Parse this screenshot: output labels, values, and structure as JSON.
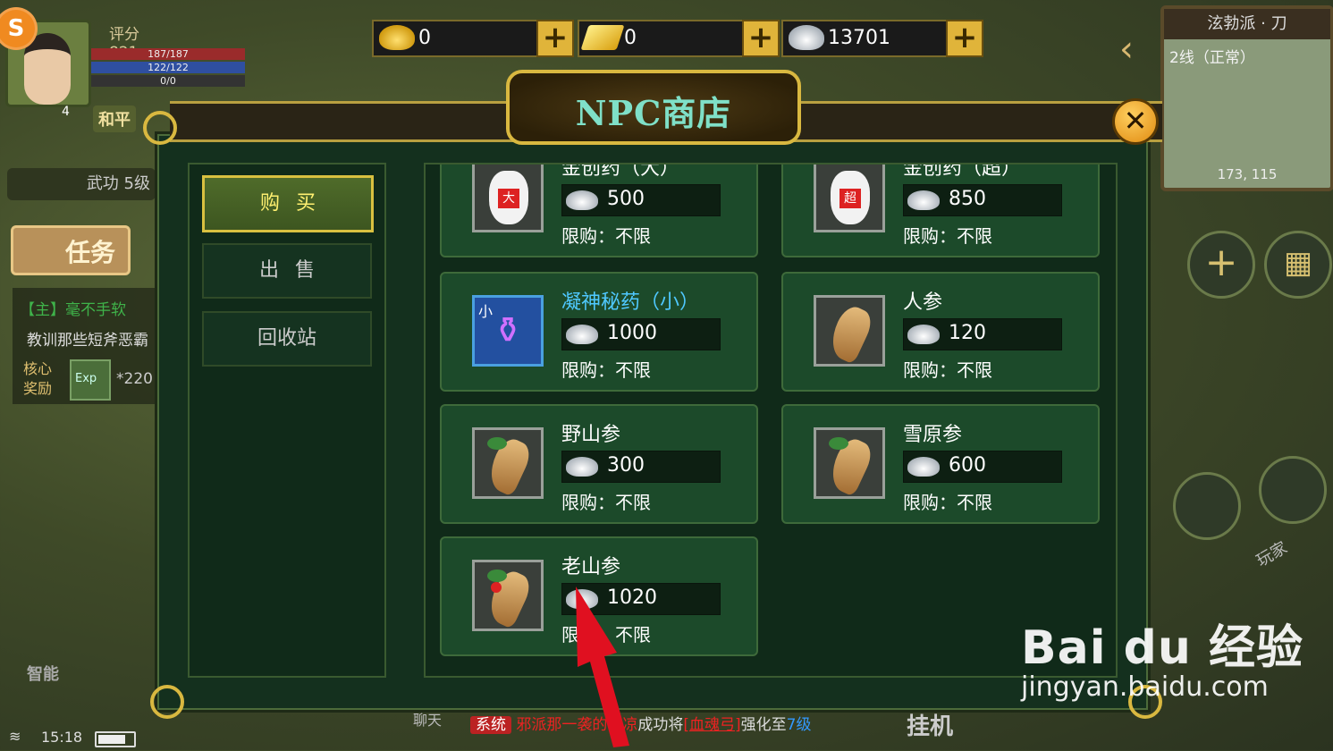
{
  "hud": {
    "score": "评分 821",
    "hp": "187/187",
    "mp": "122/122",
    "sp": "0/0",
    "level": "4",
    "pk_mode": "和平",
    "martial": "武功 5级",
    "task_button": "任务",
    "quest_title": "【主】毫不手软",
    "quest_desc": "教训那些短斧恶霸",
    "reward_label": "核心奖励",
    "reward_icon_text": "Exp",
    "reward_value": "*220",
    "smart_button": "智能",
    "time": "15:18"
  },
  "currency": [
    {
      "icon": "gold-ingot-icon",
      "value": "0"
    },
    {
      "icon": "gold-bar-icon",
      "value": "0"
    },
    {
      "icon": "silver-ingot-icon",
      "value": "13701"
    }
  ],
  "minimap": {
    "title": "泫勃派 · 刀",
    "line": "2线（正常）",
    "coords": "173, 115"
  },
  "shop": {
    "title": "NPC商店",
    "tabs": [
      {
        "label": "购买",
        "active": true
      },
      {
        "label": "出售",
        "active": false
      },
      {
        "label": "回收站",
        "active": false
      }
    ],
    "limit_text": "限购：不限",
    "items": [
      {
        "name": "金创药（大）",
        "price": "500",
        "icon": "medicine-jar-icon",
        "badge": "大",
        "highlight": false
      },
      {
        "name": "金创药（超）",
        "price": "850",
        "icon": "medicine-jar-icon",
        "badge": "超",
        "highlight": false
      },
      {
        "name": "凝神秘药（小）",
        "price": "1000",
        "icon": "potion-bottle-icon",
        "badge": "小",
        "highlight": true
      },
      {
        "name": "人参",
        "price": "120",
        "icon": "ginseng-icon",
        "badge": "",
        "highlight": false
      },
      {
        "name": "野山参",
        "price": "300",
        "icon": "wild-ginseng-icon",
        "badge": "",
        "highlight": false
      },
      {
        "name": "雪原参",
        "price": "600",
        "icon": "snow-ginseng-icon",
        "badge": "",
        "highlight": false
      },
      {
        "name": "老山参",
        "price": "1020",
        "icon": "old-ginseng-icon",
        "badge": "",
        "highlight": false
      }
    ]
  },
  "chat": {
    "tab": "聊天",
    "tag": "系统",
    "part1": "邪派那一袭的微凉",
    "part2": "成功将",
    "item": "[血魂弓]",
    "part3": "强化至",
    "level": "7级",
    "hang": "挂机",
    "player": "玩家"
  },
  "watermark": {
    "brand": "Bai du 经验",
    "url": "jingyan.baidu.com"
  },
  "colors": {
    "dialog_bg": "#14301e",
    "item_bg": "#1c4a2a",
    "gold_accent": "#d9b840",
    "title_text": "#7fe0c8",
    "highlight_name": "#4fc8ff",
    "annotation_arrow": "#e01020"
  }
}
